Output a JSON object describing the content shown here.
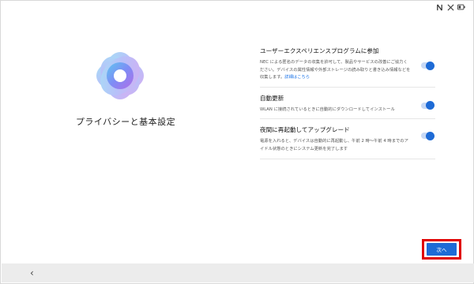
{
  "status_icons": [
    "nfc-icon",
    "signal-off-icon",
    "battery-icon"
  ],
  "page": {
    "title": "プライバシーと基本設定"
  },
  "settings": [
    {
      "title": "ユーザーエクスペリエンスプログラムに参加",
      "description": "NEC による匿名のデータの収集を許可して、製品やサービスの改善にご協力ください。デバイスの属性情報や外部ストレージの読み取りと書き込み情報などを収集します。",
      "link": "詳細はこちら",
      "enabled": true
    },
    {
      "title": "自動更新",
      "description": "WLAN に接続されているときに自動的にダウンロードしてインストール",
      "enabled": true
    },
    {
      "title": "夜間に再起動してアップグレード",
      "description": "電源を入れると、デバイスは自動的に再起動し、午前 2 時〜午前 4 時までのアイドル状態のときにシステム更新を完了します",
      "enabled": true
    }
  ],
  "next_button": {
    "label": "次へ"
  },
  "colors": {
    "accent": "#1e6bd6",
    "highlight": "#e00000"
  }
}
